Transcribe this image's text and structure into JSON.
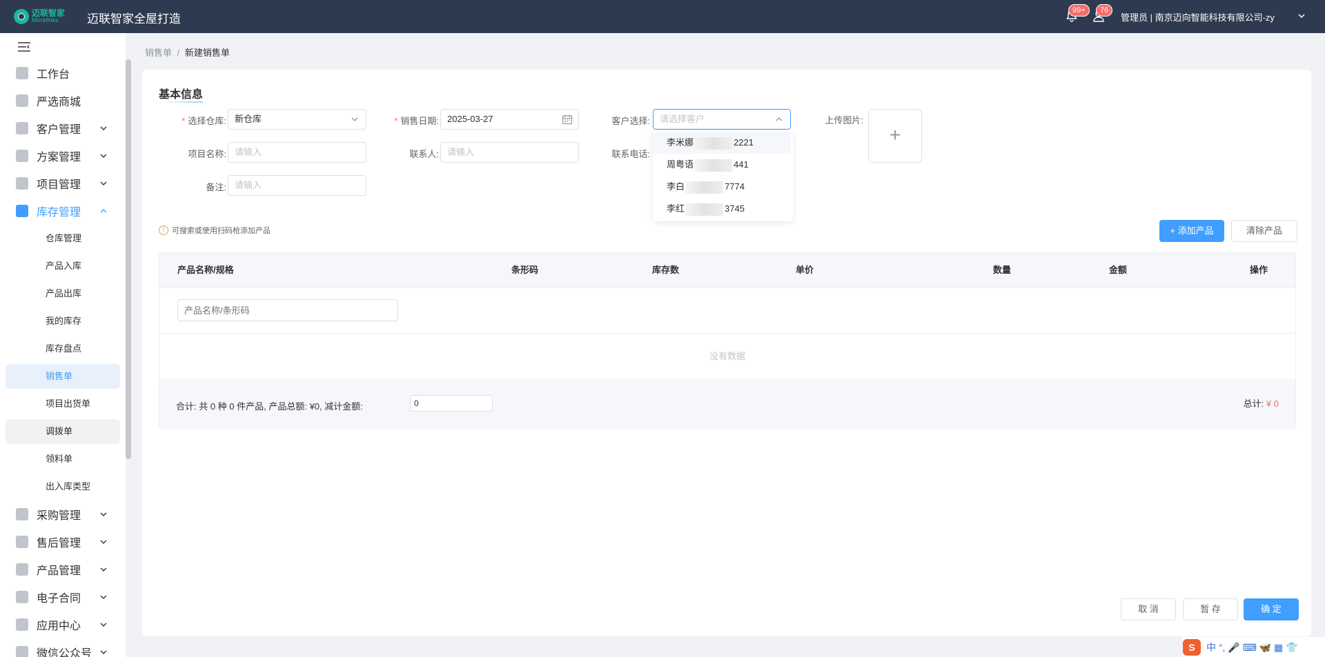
{
  "topbar": {
    "logo_cn": "迈联智家",
    "logo_en": "Morelinks",
    "title": "迈联智家全屋打造",
    "notif_badge": "99+",
    "msg_badge": "76",
    "user": "管理员 | 南京迈向智能科技有限公司-zy"
  },
  "sidebar": {
    "menu": [
      {
        "label": "工作台"
      },
      {
        "label": "严选商城"
      },
      {
        "label": "客户管理"
      },
      {
        "label": "方案管理"
      },
      {
        "label": "项目管理"
      },
      {
        "label": "库存管理"
      },
      {
        "label": "采购管理"
      },
      {
        "label": "售后管理"
      },
      {
        "label": "产品管理"
      },
      {
        "label": "电子合同"
      },
      {
        "label": "应用中心"
      },
      {
        "label": "微信公众号"
      }
    ],
    "inventory_sub": [
      {
        "label": "仓库管理"
      },
      {
        "label": "产品入库"
      },
      {
        "label": "产品出库"
      },
      {
        "label": "我的库存"
      },
      {
        "label": "库存盘点"
      },
      {
        "label": "销售单"
      },
      {
        "label": "项目出货单"
      },
      {
        "label": "调拨单"
      },
      {
        "label": "领料单"
      },
      {
        "label": "出入库类型"
      }
    ]
  },
  "breadcrumb": {
    "parent": "销售单",
    "separator": "/",
    "current": "新建销售单"
  },
  "form": {
    "section_title": "基本信息",
    "warehouse_label": "选择仓库:",
    "warehouse_value": "新仓库",
    "date_label": "销售日期:",
    "date_value": "2025-03-27",
    "customer_label": "客户选择:",
    "customer_placeholder": "请选择客户",
    "upload_label": "上传图片:",
    "upload_plus": "+",
    "project_label": "项目名称:",
    "project_placeholder": "请输入",
    "contact_label": "联系人:",
    "contact_placeholder": "请输入",
    "phone_label": "联系电话:",
    "remark_label": "备注:",
    "remark_placeholder": "请输入",
    "required_mark": "*"
  },
  "customer_options": [
    {
      "name": "李米娜",
      "phone_tail": "2221"
    },
    {
      "name": "周粤语",
      "phone_tail": "441"
    },
    {
      "name": "李白",
      "phone_tail": "7774"
    },
    {
      "name": "李红",
      "phone_tail": "3745"
    }
  ],
  "tip": {
    "icon": "!",
    "text": "可搜索或使用扫码枪添加产品"
  },
  "buttons": {
    "add_product": "+ 添加产品",
    "clear_product": "清除产品",
    "cancel": "取 消",
    "save_draft": "暂 存",
    "confirm": "确 定"
  },
  "table": {
    "headers": [
      "产品名称/规格",
      "条形码",
      "库存数",
      "单价",
      "数量",
      "金额",
      "操作"
    ],
    "search_placeholder": "产品名称/条形码",
    "empty_text": "没有数据",
    "summary": "合计: 共 0 种 0 件产品, 产品总额: ¥0, 减计金额:",
    "discount_value": "0",
    "total_label": "总计:",
    "total_value": "¥ 0"
  },
  "ime": {
    "s": "S",
    "text": "中 °, 🎤 ⌨ 🦋 ▦ 👕"
  },
  "colors": {
    "primary": "#409eff",
    "topbar": "#2d3a4f",
    "danger": "#f56c6c",
    "accent": "#18b7a0"
  }
}
